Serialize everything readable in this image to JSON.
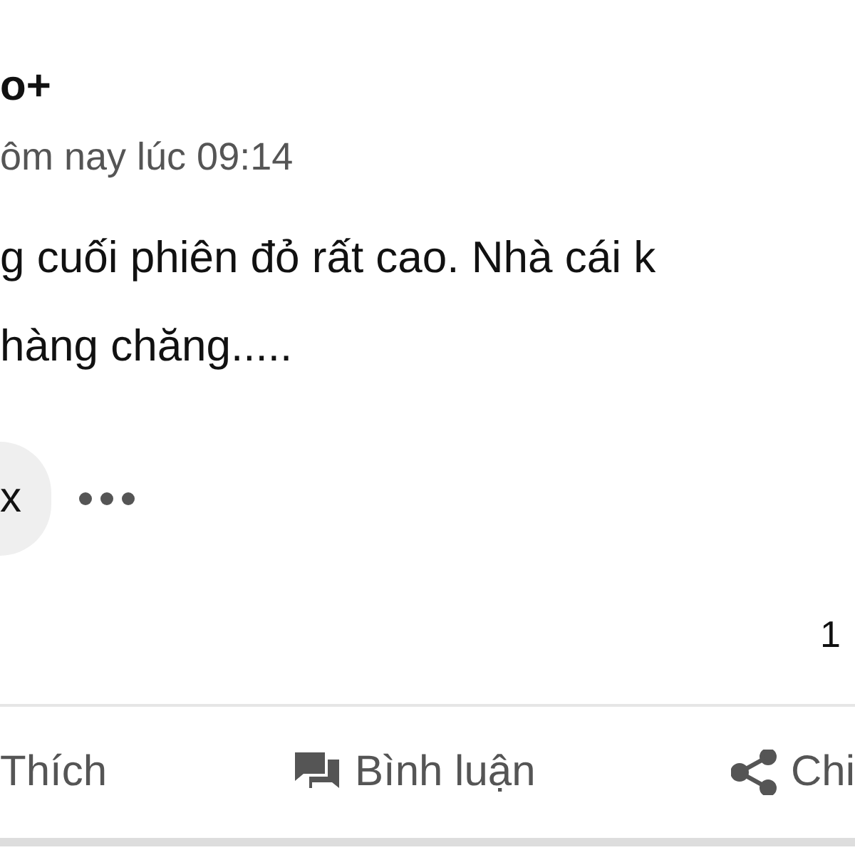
{
  "post": {
    "author": "o+",
    "time": "ôm nay lúc 09:14",
    "text_lines": [
      "g cuối phiên đỏ rất cao. Nhà cái k",
      "hàng chăng....."
    ]
  },
  "reaction": {
    "label": "x"
  },
  "count": "1",
  "actions": [
    {
      "kind": "like",
      "label": "Thích"
    },
    {
      "kind": "comment",
      "label": "Bình luận"
    },
    {
      "kind": "share",
      "label": "Chi"
    }
  ]
}
